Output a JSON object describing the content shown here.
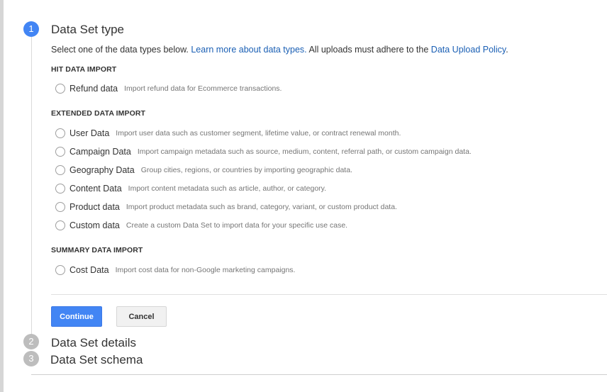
{
  "steps": [
    {
      "number": "1",
      "title": "Data Set type"
    },
    {
      "number": "2",
      "title": "Data Set details"
    },
    {
      "number": "3",
      "title": "Data Set schema"
    }
  ],
  "intro": {
    "prefix": "Select one of the data types below. ",
    "link1": "Learn more about data types.",
    "middle": " All uploads must adhere to the ",
    "link2": "Data Upload Policy",
    "suffix": "."
  },
  "sections": {
    "hit": {
      "header": "HIT DATA IMPORT",
      "options": [
        {
          "label": "Refund data",
          "desc": "Import refund data for Ecommerce transactions."
        }
      ]
    },
    "extended": {
      "header": "EXTENDED DATA IMPORT",
      "options": [
        {
          "label": "User Data",
          "desc": "Import user data such as customer segment, lifetime value, or contract renewal month."
        },
        {
          "label": "Campaign Data",
          "desc": "Import campaign metadata such as source, medium, content, referral path, or custom campaign data."
        },
        {
          "label": "Geography Data",
          "desc": "Group cities, regions, or countries by importing geographic data."
        },
        {
          "label": "Content Data",
          "desc": "Import content metadata such as article, author, or category."
        },
        {
          "label": "Product data",
          "desc": "Import product metadata such as brand, category, variant, or custom product data."
        },
        {
          "label": "Custom data",
          "desc": "Create a custom Data Set to import data for your specific use case."
        }
      ]
    },
    "summary": {
      "header": "SUMMARY DATA IMPORT",
      "options": [
        {
          "label": "Cost Data",
          "desc": "Import cost data for non-Google marketing campaigns."
        }
      ]
    }
  },
  "buttons": {
    "continue": "Continue",
    "cancel": "Cancel"
  },
  "colors": {
    "accent": "#4285f4",
    "link": "#1a5fb4",
    "step_inactive": "#bdbdbd"
  }
}
